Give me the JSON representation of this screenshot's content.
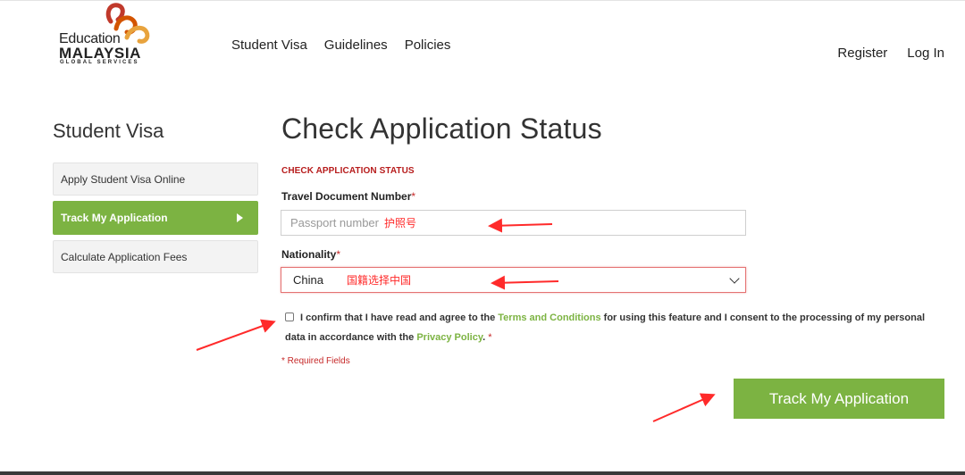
{
  "logo": {
    "line1": "Education",
    "line2": "MALAYSIA",
    "line3": "GLOBAL SERVICES"
  },
  "header": {
    "nav": [
      "Student Visa",
      "Guidelines",
      "Policies"
    ],
    "register": "Register",
    "login": "Log In"
  },
  "sidebar": {
    "title": "Student Visa",
    "items": [
      {
        "label": "Apply Student Visa Online",
        "active": false
      },
      {
        "label": "Track My Application",
        "active": true
      },
      {
        "label": "Calculate Application Fees",
        "active": false
      }
    ]
  },
  "main": {
    "title": "Check Application Status",
    "section_label": "CHECK APPLICATION STATUS",
    "travel_doc_label": "Travel Document Number",
    "travel_doc_placeholder": "Passport number",
    "nationality_label": "Nationality",
    "nationality_value": "China",
    "required_mark": "*",
    "consent_prefix": "I confirm that I have read and agree to the",
    "terms_link": "Terms and Conditions",
    "consent_middle": "for using this feature and I consent to the processing of my personal data in accordance with the",
    "privacy_link": "Privacy Policy",
    "consent_suffix": ".",
    "required_note": "* Required Fields",
    "submit_label": "Track My Application"
  },
  "annotations": {
    "passport_note": "护照号",
    "nationality_note": "国籍选择中国",
    "color": "#ff2a2a"
  },
  "colors": {
    "accent_green": "#7cb342",
    "required_red": "#c62828"
  }
}
